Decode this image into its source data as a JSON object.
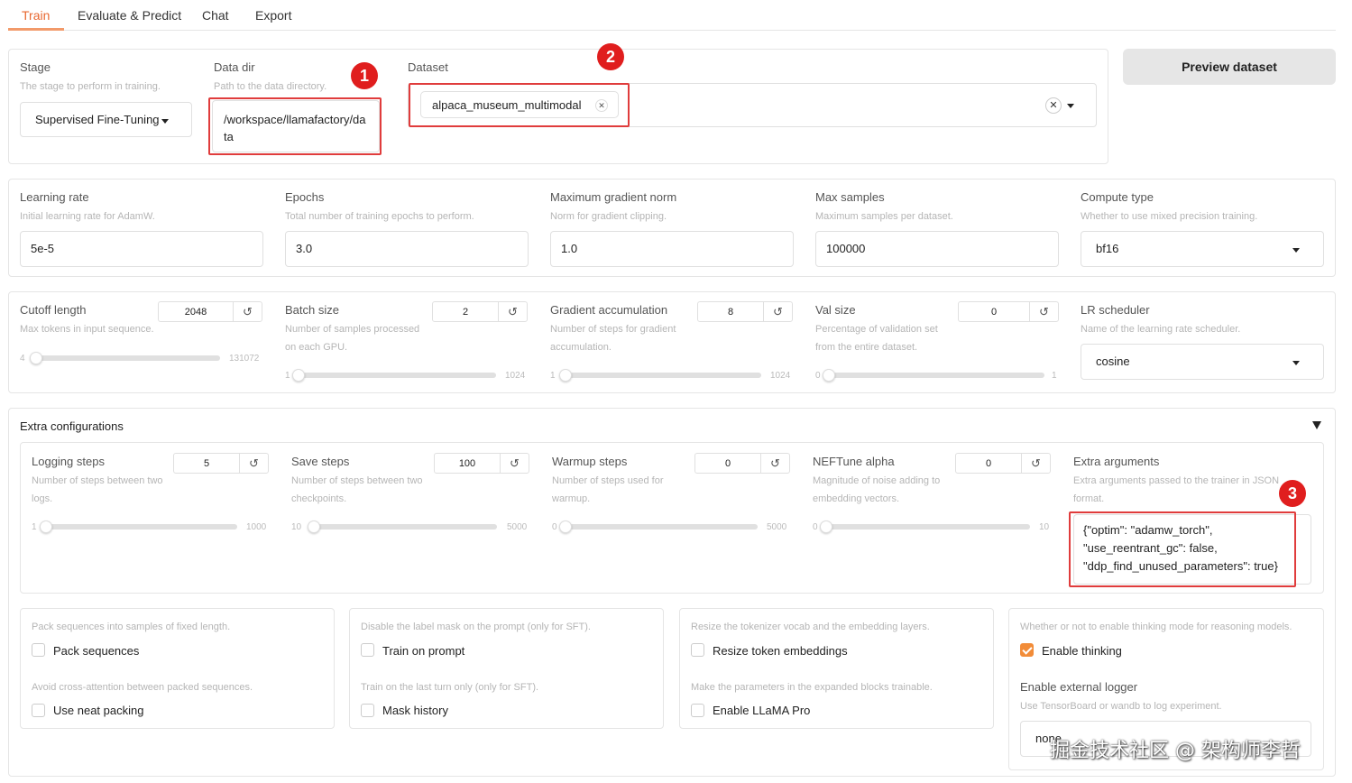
{
  "tabs": [
    "Train",
    "Evaluate & Predict",
    "Chat",
    "Export"
  ],
  "preview_button": "Preview dataset",
  "stage": {
    "label": "Stage",
    "info": "The stage to perform in training.",
    "value": "Supervised Fine-Tuning"
  },
  "data_dir": {
    "label": "Data dir",
    "info": "Path to the data directory.",
    "value_line1": "/workspace/llamafactory/da",
    "value_line2": "ta"
  },
  "dataset": {
    "label": "Dataset",
    "chip": "alpaca_museum_multimodal"
  },
  "learning_rate": {
    "label": "Learning rate",
    "info": "Initial learning rate for AdamW.",
    "value": "5e-5"
  },
  "epochs": {
    "label": "Epochs",
    "info": "Total number of training epochs to perform.",
    "value": "3.0"
  },
  "max_grad_norm": {
    "label": "Maximum gradient norm",
    "info": "Norm for gradient clipping.",
    "value": "1.0"
  },
  "max_samples": {
    "label": "Max samples",
    "info": "Maximum samples per dataset.",
    "value": "100000"
  },
  "compute_type": {
    "label": "Compute type",
    "info": "Whether to use mixed precision training.",
    "value": "bf16"
  },
  "cutoff_len": {
    "label": "Cutoff length",
    "info": "Max tokens in input sequence.",
    "value": "2048",
    "min": "4",
    "max": "131072",
    "level": 0.0156
  },
  "batch_size": {
    "label": "Batch size",
    "info_line1": "Number of samples processed",
    "info_line2": "on each GPU.",
    "value": "2",
    "min": "1",
    "max": "1024",
    "level": 0.001
  },
  "grad_accum": {
    "label": "Gradient accumulation",
    "info_line1": "Number of steps for gradient",
    "info_line2": "accumulation.",
    "value": "8",
    "min": "1",
    "max": "1024",
    "level": 0.007
  },
  "val_size": {
    "label": "Val size",
    "info_line1": "Percentage of validation set",
    "info_line2": "from the entire dataset.",
    "value": "0",
    "min": "0",
    "max": "1",
    "level": 0
  },
  "lr_scheduler": {
    "label": "LR scheduler",
    "info": "Name of the learning rate scheduler.",
    "value": "cosine"
  },
  "extra": {
    "title": "Extra configurations"
  },
  "logging_steps": {
    "label": "Logging steps",
    "info_line1": "Number of steps between two",
    "info_line2": "logs.",
    "value": "5",
    "min": "1",
    "max": "1000",
    "level": 0.004
  },
  "save_steps": {
    "label": "Save steps",
    "info_line1": "Number of steps between two",
    "info_line2": "checkpoints.",
    "value": "100",
    "min": "10",
    "max": "5000",
    "level": 0.018
  },
  "warmup_steps": {
    "label": "Warmup steps",
    "info_line1": "Number of steps used for",
    "info_line2": "warmup.",
    "value": "0",
    "min": "0",
    "max": "5000",
    "level": 0
  },
  "neftune": {
    "label": "NEFTune alpha",
    "info_line1": "Magnitude of noise adding to",
    "info_line2": "embedding vectors.",
    "value": "0",
    "min": "0",
    "max": "10",
    "level": 0
  },
  "extra_args": {
    "label": "Extra arguments",
    "info_line1": "Extra arguments passed to the trainer in JSON",
    "info_line2": "format.",
    "line1": "{\"optim\": \"adamw_torch\",",
    "line2": "\"use_reentrant_gc\": false,",
    "line3": "\"ddp_find_unused_parameters\": true}"
  },
  "pack": {
    "info": "Pack sequences into samples of fixed length.",
    "label": "Pack sequences",
    "checked": false
  },
  "neat": {
    "info": "Avoid cross-attention between packed sequences.",
    "label": "Use neat packing",
    "checked": false
  },
  "train_on_prompt": {
    "info": "Disable the label mask on the prompt (only for SFT).",
    "label": "Train on prompt",
    "checked": false
  },
  "mask_history": {
    "info": "Train on the last turn only (only for SFT).",
    "label": "Mask history",
    "checked": false
  },
  "resize_vocab": {
    "info": "Resize the tokenizer vocab and the embedding layers.",
    "label": "Resize token embeddings",
    "checked": false
  },
  "llama_pro": {
    "info": "Make the parameters in the expanded blocks trainable.",
    "label": "Enable LLaMA Pro",
    "checked": false
  },
  "thinking": {
    "info": "Whether or not to enable thinking mode for reasoning models.",
    "label": "Enable thinking",
    "checked": true
  },
  "logger": {
    "label": "Enable external logger",
    "info": "Use TensorBoard or wandb to log experiment.",
    "value": "none"
  },
  "badges": [
    "1",
    "2",
    "3"
  ],
  "watermark": "掘金技术社区 @ 架构师李哲",
  "colors": {
    "accent": "#f28c38",
    "annotation_red": "#e03c3c"
  }
}
